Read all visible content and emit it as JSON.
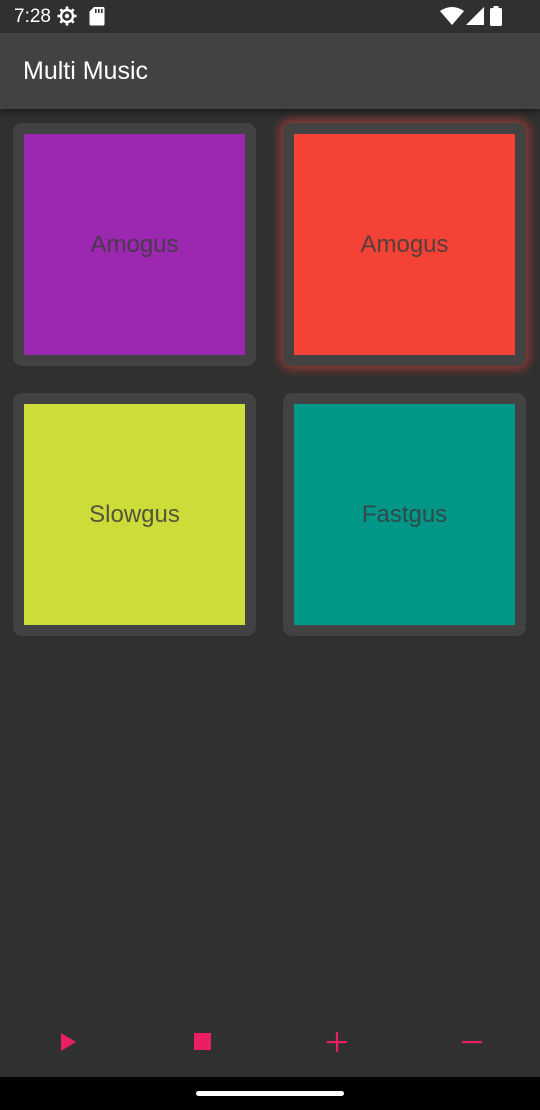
{
  "status_bar": {
    "time": "7:28",
    "icons": [
      "settings-gear-icon",
      "sd-card-icon",
      "wifi-icon",
      "signal-icon",
      "battery-icon"
    ]
  },
  "app_bar": {
    "title": "Multi Music"
  },
  "pads": [
    {
      "label": "Amogus",
      "color": "#9C27B0",
      "active": false
    },
    {
      "label": "Amogus",
      "color": "#F44336",
      "active": true
    },
    {
      "label": "Slowgus",
      "color": "#CDDC39",
      "active": false
    },
    {
      "label": "Fastgus",
      "color": "#009688",
      "active": false
    }
  ],
  "controls": {
    "accent_color": "#E91E63",
    "buttons": [
      "play-icon",
      "stop-icon",
      "add-icon",
      "remove-icon"
    ]
  },
  "colors": {
    "background": "#303030",
    "app_bar": "#424242",
    "pad_frame": "#424242"
  }
}
